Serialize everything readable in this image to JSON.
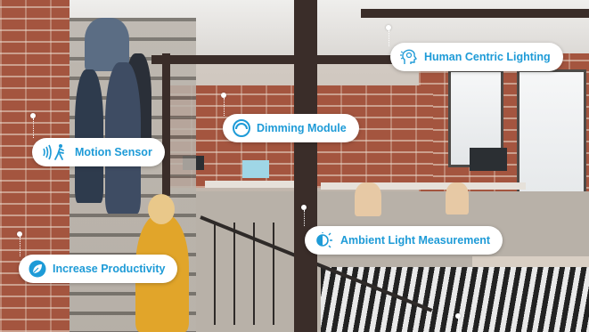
{
  "colors": {
    "accent": "#1e9bd7"
  },
  "labels": [
    {
      "id": "human-centric-lighting",
      "text": "Human Centric Lighting",
      "icon": "head-lightbulb-icon"
    },
    {
      "id": "dimming-module",
      "text": "Dimming Module",
      "icon": "dimmer-ring-icon"
    },
    {
      "id": "motion-sensor",
      "text": "Motion Sensor",
      "icon": "motion-waves-walker-icon"
    },
    {
      "id": "ambient-light-measurement",
      "text": "Ambient Light Measurement",
      "icon": "half-sun-icon"
    },
    {
      "id": "increase-productivity",
      "text": "Increase Productivity",
      "icon": "leaf-gauge-icon"
    }
  ]
}
